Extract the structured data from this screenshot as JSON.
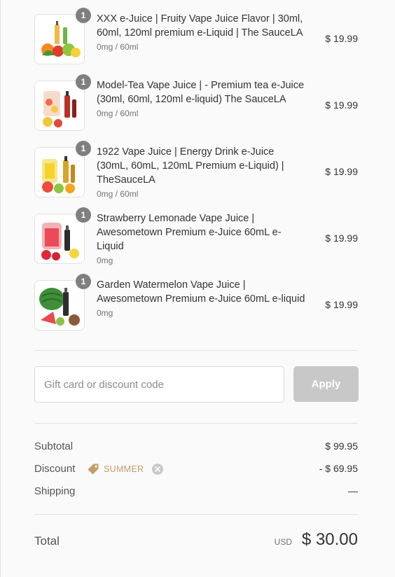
{
  "items": [
    {
      "qty": "1",
      "title": "XXX e-Juice | Fruity Vape Juice Flavor | 30ml, 60ml, 120ml premium e-Liquid | The SauceLA",
      "variant": "0mg / 60ml",
      "price": "$ 19.99"
    },
    {
      "qty": "1",
      "title": "Model-Tea Vape Juice | - Premium tea e-Juice (30ml, 60ml, 120ml e-liquid) The SauceLA",
      "variant": "0mg / 60ml",
      "price": "$ 19.99"
    },
    {
      "qty": "1",
      "title": "1922 Vape Juice | Energy Drink e-Juice (30mL, 60mL, 120mL Premium e-Liquid) | TheSauceLA",
      "variant": "0mg / 60ml",
      "price": "$ 19.99"
    },
    {
      "qty": "1",
      "title": "Strawberry Lemonade Vape Juice | Awesometown Premium e-Juice 60mL e-Liquid",
      "variant": "0mg",
      "price": "$ 19.99"
    },
    {
      "qty": "1",
      "title": "Garden Watermelon Vape Juice | Awesometown Premium e-Juice 60mL e-liquid",
      "variant": "0mg",
      "price": "$ 19.99"
    }
  ],
  "discount": {
    "placeholder": "Gift card or discount code",
    "apply_label": "Apply"
  },
  "summary": {
    "subtotal_label": "Subtotal",
    "subtotal_value": "$ 99.95",
    "discount_label": "Discount",
    "discount_code": "SUMMER",
    "discount_value": "- $ 69.95",
    "shipping_label": "Shipping",
    "shipping_value": "—"
  },
  "total": {
    "label": "Total",
    "currency": "USD",
    "amount": "$ 30.00"
  },
  "icons": {
    "tag": "tag-icon",
    "remove": "close-circle-icon"
  },
  "colors": {
    "accent_tag": "#c59c6c",
    "badge": "#7f7f7f",
    "apply_disabled": "#c8c8c8"
  }
}
